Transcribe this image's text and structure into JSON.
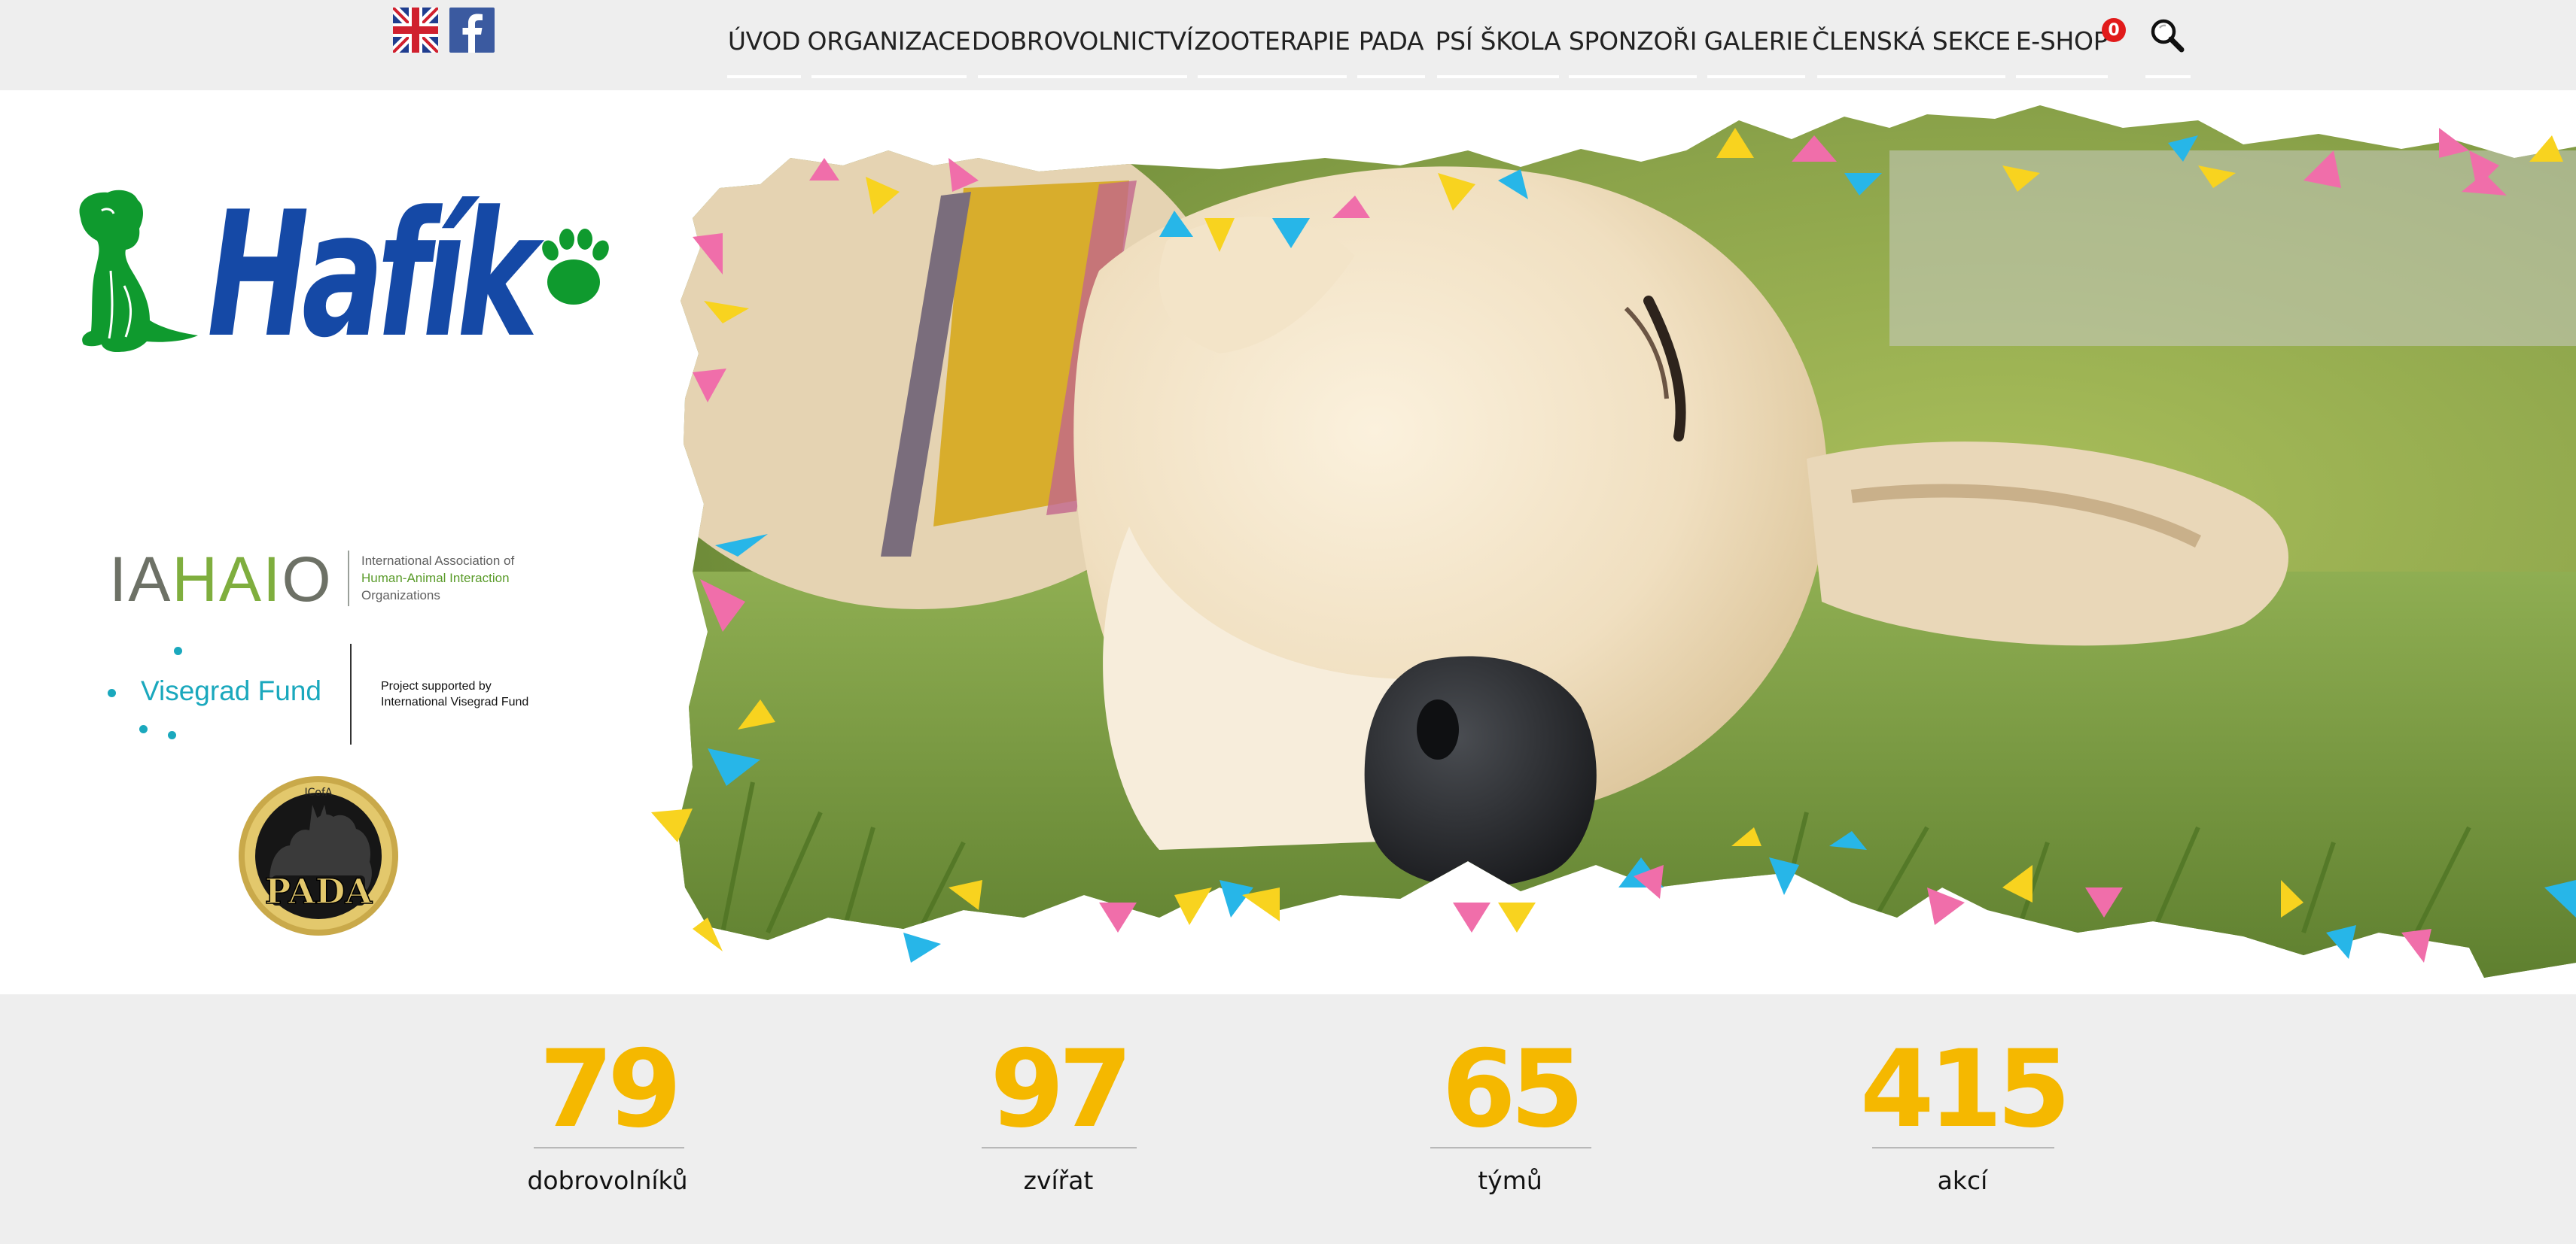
{
  "header": {
    "lang_flag_icon": "uk-flag-icon",
    "social_icon": "facebook-icon",
    "nav": [
      {
        "label": "ÚVOD"
      },
      {
        "label": "ORGANIZACE"
      },
      {
        "label": "DOBROVOLNICTVÍ"
      },
      {
        "label": "ZOOTERAPIE"
      },
      {
        "label": "PADA"
      },
      {
        "label": "PSÍ ŠKOLA"
      },
      {
        "label": "SPONZOŘI"
      },
      {
        "label": "GALERIE"
      },
      {
        "label": "ČLENSKÁ SEKCE"
      },
      {
        "label": "E-SHOP"
      }
    ],
    "cart_count": "0",
    "search_icon": "search-icon"
  },
  "logo": {
    "text": "Hafík",
    "icon": "paw-icon",
    "brand_blue": "#1549a6",
    "brand_green": "#0f9a2e"
  },
  "partners": {
    "iahaio": {
      "name_a": "IA",
      "name_b": "HAI",
      "name_c": "O",
      "line1": "International Association of",
      "line2": "Human-Animal Interaction",
      "line3": "Organizations"
    },
    "visegrad": {
      "name": "Visegrad Fund",
      "line1": "Project supported  by",
      "line2": "International Visegrad Fund"
    },
    "pada": {
      "top_text": "ICofA",
      "main_text": "PADA"
    }
  },
  "stats": [
    {
      "value": "79",
      "label": "dobrovolníků"
    },
    {
      "value": "97",
      "label": "zvířat"
    },
    {
      "value": "65",
      "label": "týmů"
    },
    {
      "value": "415",
      "label": "akcí"
    }
  ],
  "colors": {
    "accent_yellow": "#f5b800",
    "bunting_pink": "#f06eaa",
    "bunting_blue": "#27b6e8",
    "bunting_yellow": "#f8d31f"
  }
}
